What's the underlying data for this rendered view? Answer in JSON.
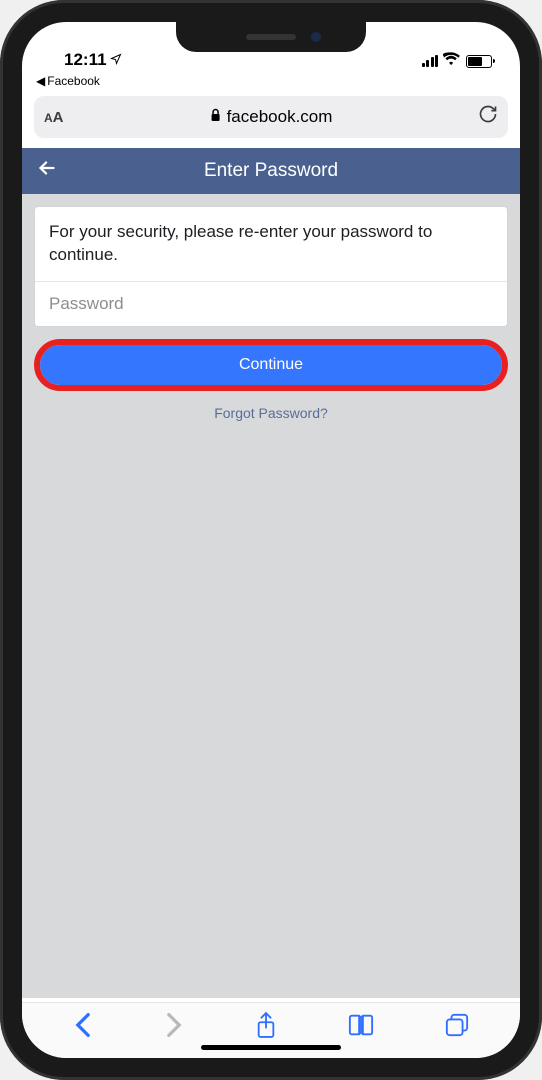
{
  "status": {
    "time": "12:11",
    "back_app": "Facebook"
  },
  "safari": {
    "domain": "facebook.com"
  },
  "page": {
    "header_title": "Enter Password",
    "security_message": "For your security, please re-enter your password to continue.",
    "password_placeholder": "Password",
    "continue_label": "Continue",
    "forgot_label": "Forgot Password?"
  }
}
